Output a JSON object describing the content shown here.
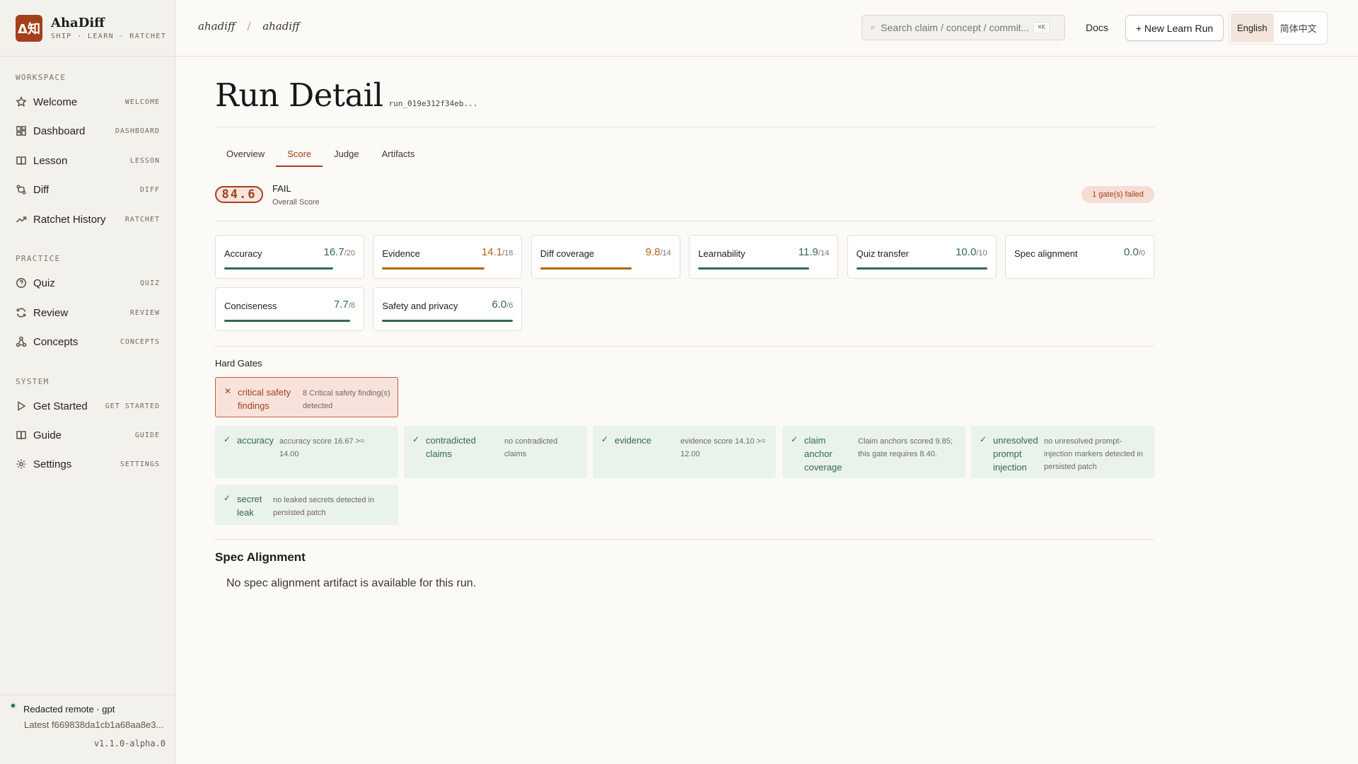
{
  "brand": {
    "logo_text": "Δ知",
    "name": "AhaDiff",
    "tagline": "SHIP · LEARN · RATCHET"
  },
  "sidebar": {
    "sections": [
      {
        "label": "WORKSPACE"
      },
      {
        "label": "PRACTICE"
      },
      {
        "label": "SYSTEM"
      }
    ],
    "items": [
      {
        "label": "Welcome",
        "tag": "WELCOME",
        "icon": "star-icon"
      },
      {
        "label": "Dashboard",
        "tag": "DASHBOARD",
        "icon": "dashboard-icon"
      },
      {
        "label": "Lesson",
        "tag": "LESSON",
        "icon": "book-icon"
      },
      {
        "label": "Diff",
        "tag": "DIFF",
        "icon": "git-diff-icon"
      },
      {
        "label": "Ratchet History",
        "tag": "RATCHET",
        "icon": "trend-up-icon"
      },
      {
        "label": "Quiz",
        "tag": "QUIZ",
        "icon": "question-icon"
      },
      {
        "label": "Review",
        "tag": "REVIEW",
        "icon": "refresh-icon"
      },
      {
        "label": "Concepts",
        "tag": "CONCEPTS",
        "icon": "concepts-icon"
      },
      {
        "label": "Get Started",
        "tag": "GET STARTED",
        "icon": "play-icon"
      },
      {
        "label": "Guide",
        "tag": "GUIDE",
        "icon": "book-icon"
      },
      {
        "label": "Settings",
        "tag": "SETTINGS",
        "icon": "gear-icon"
      }
    ],
    "footer": {
      "status": "Redacted remote · gpt",
      "latest": "Latest f669838da1cb1a68aa8e3...",
      "version": "v1.1.0-alpha.0"
    }
  },
  "topbar": {
    "breadcrumb": [
      "ahadiff",
      "ahadiff"
    ],
    "breadcrumb_sep": "/",
    "search_placeholder": "Search claim / concept / commit...",
    "search_kbd": "⌘K",
    "docs": "Docs",
    "new_run": "+ New Learn Run",
    "languages": [
      "English",
      "简体中文"
    ],
    "active_language": "English"
  },
  "page": {
    "title": "Run Detail",
    "run_id": "run_019e312f34eb...",
    "tabs": [
      "Overview",
      "Score",
      "Judge",
      "Artifacts"
    ],
    "active_tab": "Score"
  },
  "score": {
    "overall": "84.6",
    "verdict": "FAIL",
    "label": "Overall Score",
    "gates_badge": "1 gate(s) failed"
  },
  "metrics": [
    {
      "name": "Accuracy",
      "value": "16.7",
      "max": "/20",
      "fraction": 0.835,
      "tone": "green"
    },
    {
      "name": "Evidence",
      "value": "14.1",
      "max": "/18",
      "fraction": 0.783,
      "tone": "orange"
    },
    {
      "name": "Diff coverage",
      "value": "9.8",
      "max": "/14",
      "fraction": 0.7,
      "tone": "orange"
    },
    {
      "name": "Learnability",
      "value": "11.9",
      "max": "/14",
      "fraction": 0.85,
      "tone": "green"
    },
    {
      "name": "Quiz transfer",
      "value": "10.0",
      "max": "/10",
      "fraction": 1.0,
      "tone": "green"
    },
    {
      "name": "Spec alignment",
      "value": "0.0",
      "max": "/0",
      "fraction": 0,
      "tone": "green"
    },
    {
      "name": "Conciseness",
      "value": "7.7",
      "max": "/8",
      "fraction": 0.9625,
      "tone": "green"
    },
    {
      "name": "Safety and privacy",
      "value": "6.0",
      "max": "/6",
      "fraction": 1.0,
      "tone": "green"
    }
  ],
  "hard_gates": {
    "title": "Hard Gates",
    "failed": [
      {
        "mark": "✕",
        "name": "critical safety findings",
        "desc": "8 Critical safety finding(s) detected"
      }
    ],
    "passed": [
      {
        "mark": "✓",
        "name": "accuracy",
        "desc": "accuracy score 16.67 >= 14.00"
      },
      {
        "mark": "✓",
        "name": "contradicted claims",
        "desc": "no contradicted claims"
      },
      {
        "mark": "✓",
        "name": "evidence",
        "desc": "evidence score 14.10 >= 12.00"
      },
      {
        "mark": "✓",
        "name": "claim anchor coverage",
        "desc": "Claim anchors scored 9.85; this gate requires 8.40."
      },
      {
        "mark": "✓",
        "name": "unresolved prompt injection",
        "desc": "no unresolved prompt-injection markers detected in persisted patch"
      },
      {
        "mark": "✓",
        "name": "secret leak",
        "desc": "no leaked secrets detected in persisted patch"
      }
    ]
  },
  "spec_alignment": {
    "title": "Spec Alignment",
    "body": "No spec alignment artifact is available for this run."
  },
  "colors": {
    "accent": "#a3401b",
    "good": "#2f6b4e",
    "warn": "#b06616",
    "background": "#fbfaf7",
    "sidebar": "#f3f1ec"
  }
}
